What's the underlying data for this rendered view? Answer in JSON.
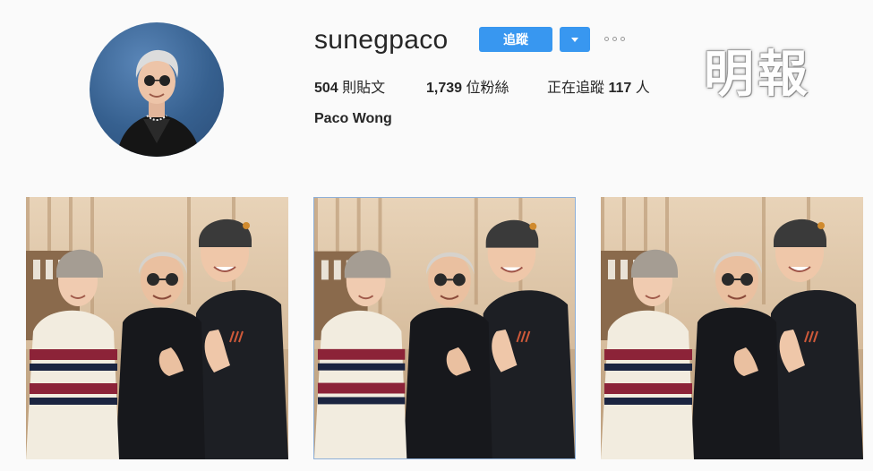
{
  "profile": {
    "username": "sunegpaco",
    "follow_label": "追蹤",
    "full_name": "Paco Wong",
    "stats": {
      "posts_count": "504",
      "posts_label": "則貼文",
      "followers_count": "1,739",
      "followers_label": "位粉絲",
      "following_prefix": "正在追蹤",
      "following_count": "117",
      "following_suffix": "人"
    }
  },
  "watermark": {
    "text": "明報"
  },
  "posts": [
    {
      "kind": "photo"
    },
    {
      "kind": "photo"
    },
    {
      "kind": "photo"
    }
  ],
  "colors": {
    "accent": "#3897f0",
    "background": "#fafafa",
    "text": "#262626"
  }
}
